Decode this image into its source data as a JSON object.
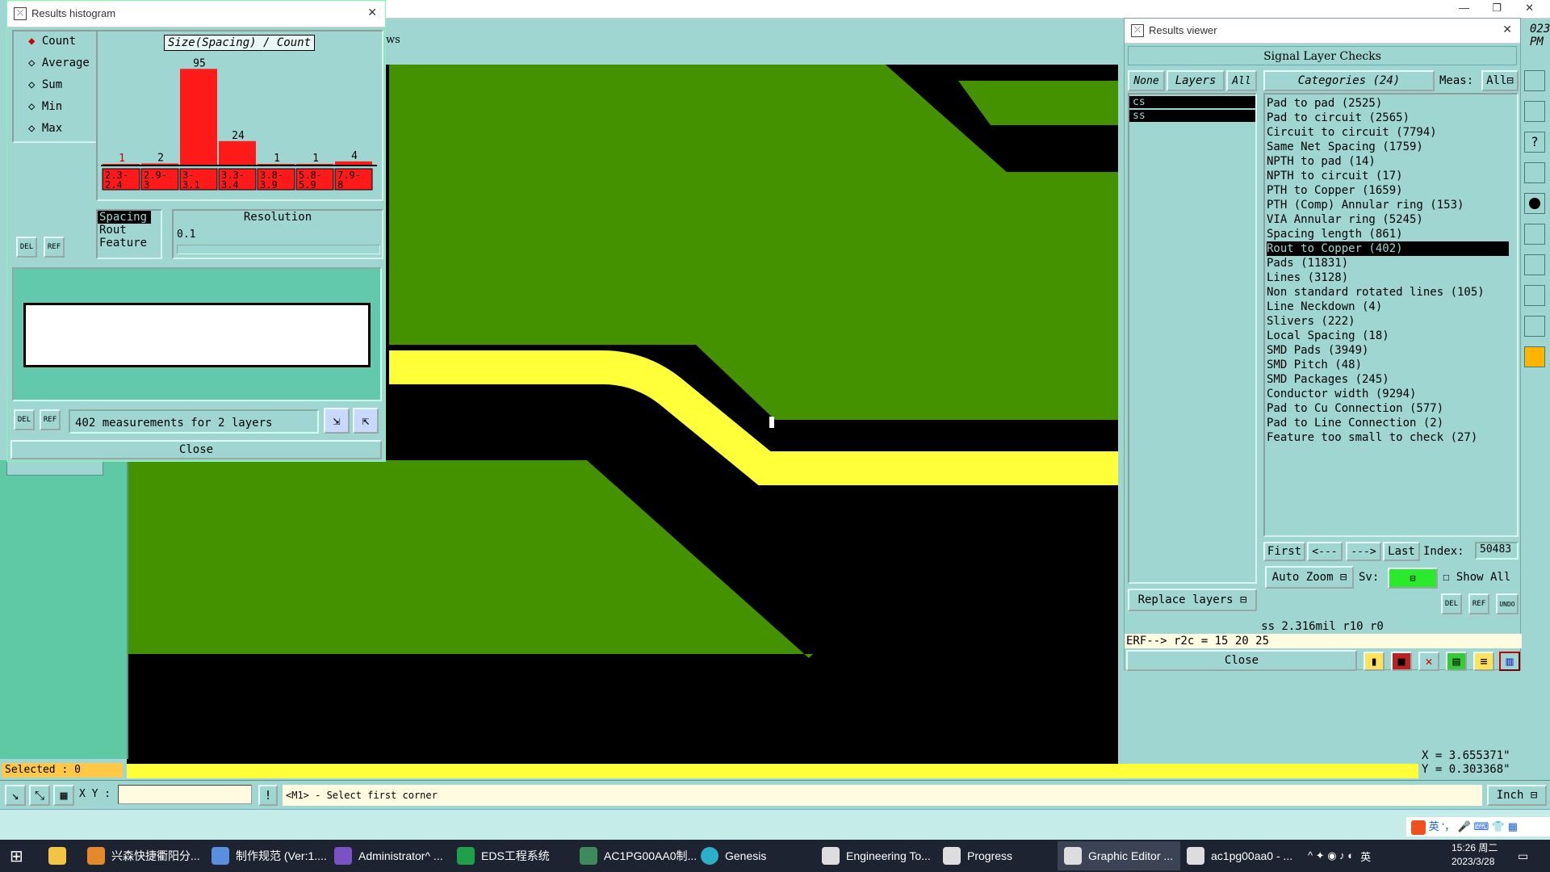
{
  "histogram": {
    "title": "Results histogram",
    "modes": [
      "Count",
      "Average",
      "Sum",
      "Min",
      "Max"
    ],
    "chart_title": "Size(Spacing) / Count",
    "bins": [
      {
        "count": "1",
        "label": "2.3-\n2.4"
      },
      {
        "count": "2",
        "label": "2.9-\n3"
      },
      {
        "count": "95",
        "label": "3-\n3.1"
      },
      {
        "count": "24",
        "label": "3.3-\n3.4"
      },
      {
        "count": "1",
        "label": "3.8-\n3.9"
      },
      {
        "count": "1",
        "label": "5.8-\n5.9"
      },
      {
        "count": "4",
        "label": "7.9-\n8"
      }
    ],
    "types": [
      "Spacing",
      "Rout",
      "Feature"
    ],
    "resolution_label": "Resolution",
    "resolution_value": "0.1",
    "del": "DEL",
    "ref": "REF",
    "summary": "402 measurements for 2 layers",
    "close": "Close"
  },
  "chart_data": {
    "type": "bar",
    "title": "Size(Spacing) / Count",
    "categories": [
      "2.3-2.4",
      "2.9-3",
      "3-3.1",
      "3.3-3.4",
      "3.8-3.9",
      "5.8-5.9",
      "7.9-8"
    ],
    "values": [
      1,
      2,
      95,
      24,
      1,
      1,
      4
    ],
    "ylim": [
      0,
      100
    ]
  },
  "viewer": {
    "title": "Results viewer",
    "header": "Signal Layer Checks",
    "none": "None",
    "layers": "Layers",
    "all": "All",
    "categories_label": "Categories (24)",
    "meas_label": "Meas:",
    "meas_value": "All",
    "layer_items": [
      "cs",
      "ss"
    ],
    "categories": [
      "Pad to pad (2525)",
      "Pad to circuit (2565)",
      "Circuit to circuit (7794)",
      "Same Net Spacing (1759)",
      "NPTH to pad (14)",
      "NPTH to circuit (17)",
      "PTH to Copper (1659)",
      "PTH (Comp) Annular ring (153)",
      "VIA Annular ring (5245)",
      "Spacing length (861)",
      "Rout to Copper (402)",
      "Pads (11831)",
      "Lines (3128)",
      "Non standard rotated lines (105)",
      "Line Neckdown (4)",
      "Slivers (222)",
      "Local Spacing (18)",
      "SMD Pads (3949)",
      "SMD Pitch (48)",
      "SMD Packages (245)",
      "Conductor width (9294)",
      "Pad to Cu Connection (577)",
      "Pad to Line Connection (2)",
      "Feature too small to check (27)"
    ],
    "selected_index": 10,
    "first": "First",
    "prev": "<---",
    "next": "--->",
    "last": "Last",
    "index_label": "Index:",
    "index_value": "50483",
    "auto_zoom": "Auto Zoom",
    "sv": "Sv:",
    "show_all": "Show All",
    "replace_layers": "Replace layers",
    "undo": "UNDO",
    "status": "ss 2.316mil  r10  r0",
    "erf": "ERF--> r2c = 15 20 25",
    "close": "Close"
  },
  "editor": {
    "partial_text": "ws",
    "selected": "Selected : 0",
    "xy_label": "X Y :",
    "xy_value": "",
    "prompt": "<M1> - Select first corner",
    "unit": "Inch",
    "coord_x": "X = 3.655371\"",
    "coord_y": "Y = 0.303368\"",
    "year_frag": "023",
    "time_frag": "PM"
  },
  "taskbar": {
    "items": [
      "兴森快捷衢阳分...",
      "制作规范 (Ver:1....",
      "Administrator^ ...",
      "EDS工程系统",
      "AC1PG00AA0制...",
      "Genesis",
      "Engineering To...",
      "Progress",
      "Graphic Editor ...",
      "ac1pg00aa0 - ..."
    ],
    "time": "15:26 周二",
    "date": "2023/3/28",
    "ime": "英"
  },
  "colors": {
    "teal": "#9fd6d2",
    "green": "#459200",
    "yellow": "#ffff3a",
    "red": "#ff1a1a"
  }
}
